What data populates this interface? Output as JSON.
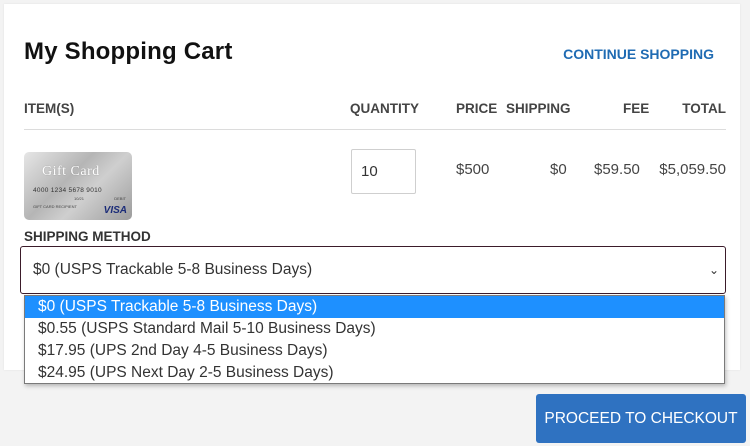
{
  "cart": {
    "title": "My Shopping Cart",
    "continue_label": "CONTINUE SHOPPING"
  },
  "table": {
    "headers": {
      "items": "ITEM(S)",
      "quantity": "QUANTITY",
      "price": "PRICE",
      "shipping": "SHIPPING",
      "fee": "FEE",
      "total": "TOTAL"
    },
    "row": {
      "card": {
        "title": "Gift Card",
        "number": "4000 1234 5678 9010",
        "expiry": "10/21",
        "debit": "DEBIT",
        "recipient": "GIFT CARD RECIPIENT",
        "brand": "VISA"
      },
      "quantity": "10",
      "price": "$500",
      "shipping": "$0",
      "fee": "$59.50",
      "total": "$5,059.50"
    }
  },
  "shipping_method": {
    "label": "SHIPPING METHOD",
    "selected": "$0 (USPS Trackable 5-8 Business Days)",
    "options": [
      "$0 (USPS Trackable 5-8 Business Days)",
      "$0.55 (USPS Standard Mail 5-10 Business Days)",
      "$17.95 (UPS 2nd Day 4-5 Business Days)",
      "$24.95 (UPS Next Day 2-5 Business Days)"
    ]
  },
  "checkout": {
    "label": "PROCEED TO CHECKOUT"
  },
  "colors": {
    "accent": "#2f72c1",
    "link": "#1f6bb3",
    "option_highlight": "#1e90ff",
    "select_border": "#3b1b2a"
  }
}
